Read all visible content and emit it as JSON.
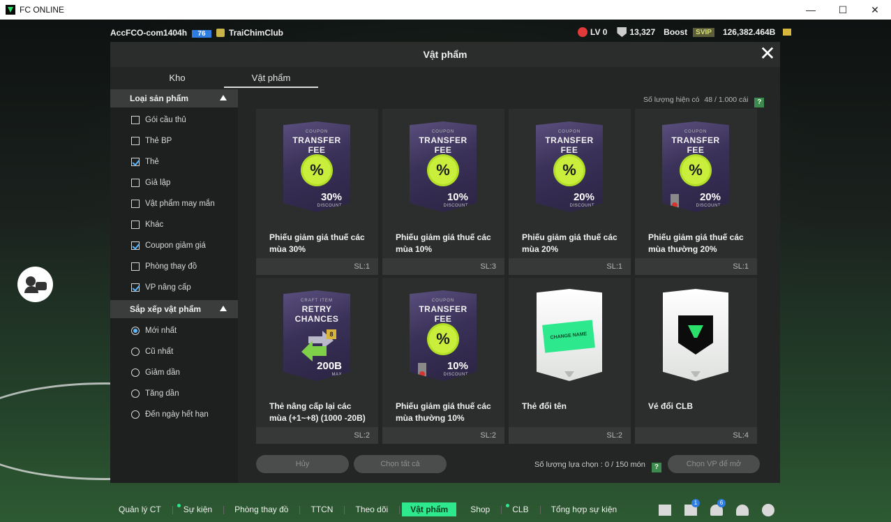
{
  "window": {
    "title": "FC ONLINE",
    "minimize": "—",
    "maximize": "☐",
    "close": "✕"
  },
  "topbar": {
    "account": "AccFCO-com1404h",
    "account_level": "76",
    "club": "TraiChimClub",
    "lv": "LV 0",
    "points": "13,327",
    "boost": "Boost",
    "svip": "SVIP",
    "bp": "126,382.464B"
  },
  "modal": {
    "title": "Vật phẩm",
    "close": "✕",
    "tabs": [
      "Kho",
      "Vật phẩm"
    ],
    "active_tab": "Vật phẩm",
    "count_label": "Số lượng hiện có",
    "count_value": "48 / 1.000 cái",
    "help": "?"
  },
  "filters": {
    "section_title": "Loại sản phẩm",
    "items": [
      {
        "label": "Gói cầu thủ",
        "checked": false
      },
      {
        "label": "Thẻ BP",
        "checked": false
      },
      {
        "label": "Thẻ",
        "checked": true
      },
      {
        "label": "Giả lập",
        "checked": false
      },
      {
        "label": "Vật phẩm may mắn",
        "checked": false
      },
      {
        "label": "Khác",
        "checked": false
      },
      {
        "label": "Coupon giảm giá",
        "checked": true
      },
      {
        "label": "Phòng thay đồ",
        "checked": false
      },
      {
        "label": "VP nâng cấp",
        "checked": true
      }
    ]
  },
  "sort": {
    "section_title": "Sắp xếp vật phẩm",
    "options": [
      {
        "label": "Mới nhất",
        "selected": true
      },
      {
        "label": "Cũ nhất",
        "selected": false
      },
      {
        "label": "Giảm dần",
        "selected": false
      },
      {
        "label": "Tăng dần",
        "selected": false
      },
      {
        "label": "Đến ngày hết hạn",
        "selected": false
      }
    ]
  },
  "items": [
    {
      "name": "Phiếu giảm giá thuế các mùa 30%",
      "qty": "SL:1",
      "kind": "coupon",
      "coupon_small": "COUPON",
      "coupon_big": "TRANSFER FEE",
      "seal": "%",
      "pct": "30%",
      "pct_sub": "DISCOUNT",
      "locked": false
    },
    {
      "name": "Phiếu giảm giá thuế các mùa 10%",
      "qty": "SL:3",
      "kind": "coupon",
      "coupon_small": "COUPON",
      "coupon_big": "TRANSFER FEE",
      "seal": "%",
      "pct": "10%",
      "pct_sub": "DISCOUNT",
      "locked": false
    },
    {
      "name": "Phiếu giảm giá thuế các mùa 20%",
      "qty": "SL:1",
      "kind": "coupon",
      "coupon_small": "COUPON",
      "coupon_big": "TRANSFER FEE",
      "seal": "%",
      "pct": "20%",
      "pct_sub": "DISCOUNT",
      "locked": false
    },
    {
      "name": "Phiếu giảm giá thuế các mùa thường 20%",
      "qty": "SL:1",
      "kind": "coupon",
      "coupon_small": "COUPON",
      "coupon_big": "TRANSFER FEE",
      "seal": "%",
      "pct": "20%",
      "pct_sub": "DISCOUNT",
      "locked": true
    },
    {
      "name": "Thẻ nâng cấp lại các mùa (+1~+8) (1000 -20B)",
      "qty": "SL:2",
      "kind": "retry",
      "coupon_small": "CRAFT ITEM",
      "coupon_big": "RETRY CHANCES",
      "level": "8",
      "pct": "200B",
      "pct_sub": "MAX",
      "locked": false
    },
    {
      "name": "Phiếu giảm giá thuế các mùa thường 10%",
      "qty": "SL:2",
      "kind": "coupon",
      "coupon_small": "COUPON",
      "coupon_big": "TRANSFER FEE",
      "seal": "%",
      "pct": "10%",
      "pct_sub": "DISCOUNT",
      "locked": true
    },
    {
      "name": "Thẻ đổi tên",
      "qty": "SL:2",
      "kind": "rename",
      "card_text": "CHANGE NAME"
    },
    {
      "name": "Vé đổi CLB",
      "qty": "SL:4",
      "kind": "club"
    }
  ],
  "footer": {
    "cancel": "Hủy",
    "select_all": "Chọn tất cả",
    "selected_label": "Số lượng lựa chọn : 0 / 150 món",
    "help": "?",
    "open": "Chọn VP để mở"
  },
  "nav": {
    "items": [
      {
        "label": "Quản lý CT",
        "dot": false
      },
      {
        "label": "Sự kiện",
        "dot": true
      },
      {
        "label": "Phòng thay đồ",
        "dot": false
      },
      {
        "label": "TTCN",
        "dot": false
      },
      {
        "label": "Theo dõi",
        "dot": false
      },
      {
        "label": "Vật phẩm",
        "dot": false
      },
      {
        "label": "Shop",
        "dot": false
      },
      {
        "label": "CLB",
        "dot": true
      },
      {
        "label": "Tổng hợp sự kiện",
        "dot": false
      }
    ],
    "active": "Vật phẩm",
    "icons": [
      {
        "name": "chat-icon",
        "badge": ""
      },
      {
        "name": "home-icon",
        "badge": "1"
      },
      {
        "name": "bell-icon",
        "badge": "6"
      },
      {
        "name": "profile-icon",
        "badge": ""
      },
      {
        "name": "settings-icon",
        "badge": ""
      }
    ]
  },
  "colors": {
    "accent": "#2ee88e",
    "checkbox": "#5bb7ff",
    "coupon_seal": "#c9ef3c"
  }
}
